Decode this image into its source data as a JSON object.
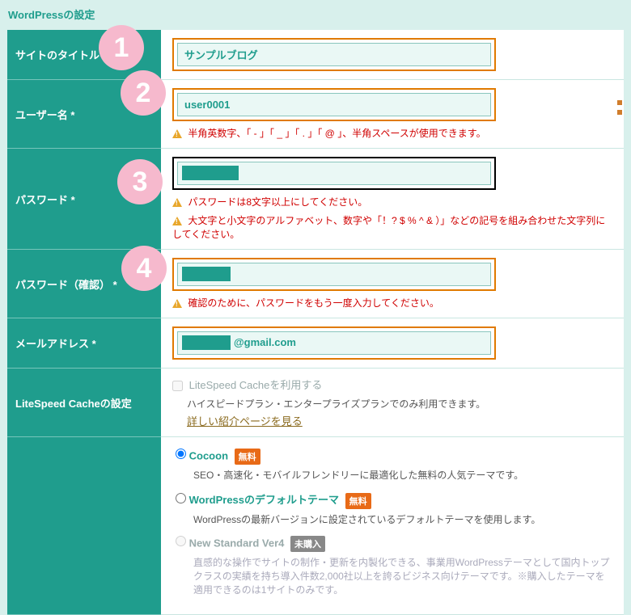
{
  "page_title": "WordPressの設定",
  "rows": {
    "site_title": {
      "label": "サイトのタイトル",
      "value": "サンプルブログ"
    },
    "username": {
      "label": "ユーザー名 *",
      "value": "user0001",
      "hint1": "半角英数字、「 - 」「 _ 」「 . 」「 @ 」、半角スペースが使用できます。"
    },
    "password": {
      "label": "パスワード *",
      "hint1": "パスワードは8文字以上にしてください。",
      "hint2": "大文字と小文字のアルファベット、数字や「！? $ % ^ & ）」などの記号を組み合わせた文字列にしてください。"
    },
    "password_confirm": {
      "label": "パスワード（確認） *",
      "hint1": "確認のために、パスワードをもう一度入力してください。"
    },
    "email": {
      "label": "メールアドレス *",
      "value_suffix": "@gmail.com"
    },
    "litespeed": {
      "label": "LiteSpeed Cacheの設定",
      "checkbox_label": "LiteSpeed Cacheを利用する",
      "desc": "ハイスピードプラン・エンタープライズプランでのみ利用できます。",
      "link": "詳しい紹介ページを見る"
    },
    "themes": {
      "cocoon": {
        "label": "Cocoon",
        "badge": "無料",
        "desc": "SEO・高速化・モバイルフレンドリーに最適化した無料の人気テーマです。"
      },
      "default": {
        "label": "WordPressのデフォルトテーマ",
        "badge": "無料",
        "desc": "WordPressの最新バージョンに設定されているデフォルトテーマを使用します。"
      },
      "newstandard": {
        "label": "New Standard Ver4",
        "badge": "未購入",
        "desc": "直感的な操作でサイトの制作・更新を内製化できる、事業用WordPressテーマとして国内トップクラスの実績を持ち導入件数2,000社以上を誇るビジネス向けテーマです。※購入したテーマを適用できるのは1サイトのみです。"
      }
    }
  },
  "markers": {
    "m1": "1",
    "m2": "2",
    "m3": "3",
    "m4": "4"
  }
}
